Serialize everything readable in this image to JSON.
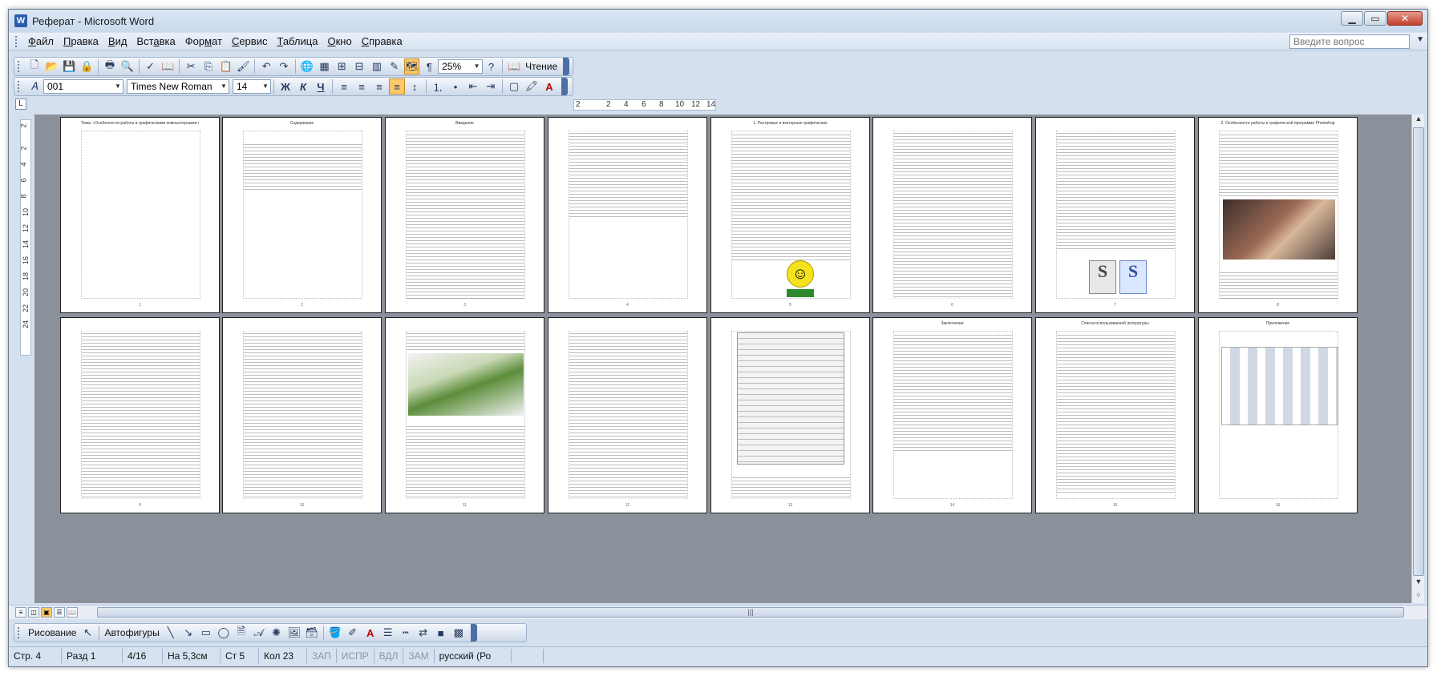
{
  "window": {
    "title": "Реферат - Microsoft Word",
    "app_icon": "W"
  },
  "menu": [
    {
      "pre": "",
      "u": "Ф",
      "post": "айл"
    },
    {
      "pre": "",
      "u": "П",
      "post": "равка"
    },
    {
      "pre": "",
      "u": "В",
      "post": "ид"
    },
    {
      "pre": "Вст",
      "u": "а",
      "post": "вка"
    },
    {
      "pre": "Фор",
      "u": "м",
      "post": "ат"
    },
    {
      "pre": "",
      "u": "С",
      "post": "ервис"
    },
    {
      "pre": "",
      "u": "Т",
      "post": "аблица"
    },
    {
      "pre": "",
      "u": "О",
      "post": "кно"
    },
    {
      "pre": "",
      "u": "С",
      "post": "правка"
    }
  ],
  "help_box": {
    "placeholder": "Введите вопрос"
  },
  "standard_toolbar": {
    "zoom": "25%",
    "read_label": "Чтение"
  },
  "formatting_toolbar": {
    "style": "001",
    "font": "Times New Roman",
    "size": "14",
    "bold": "Ж",
    "italic": "К",
    "underline": "Ч"
  },
  "ruler": {
    "ticks": [
      "2",
      "2",
      "4",
      "6",
      "8",
      "10",
      "12",
      "14"
    ],
    "vticks": [
      "2",
      "2",
      "4",
      "6",
      "8",
      "10",
      "12",
      "14",
      "16",
      "18",
      "20",
      "22",
      "24"
    ]
  },
  "pages": [
    {
      "title": "Тема: «Особенности работы в графическими компьютерными программами»"
    },
    {
      "title": "Содержание"
    },
    {
      "title": "Введение"
    },
    {
      "title": ""
    },
    {
      "title": "1. Растровые и векторные графические"
    },
    {
      "title": ""
    },
    {
      "title": ""
    },
    {
      "title": "2. Особенности работы в графической программе Photoshop"
    },
    {
      "title": ""
    },
    {
      "title": ""
    },
    {
      "title": ""
    },
    {
      "title": ""
    },
    {
      "title": ""
    },
    {
      "title": "Заключение"
    },
    {
      "title": "Список использованной литературы"
    },
    {
      "title": "Приложение"
    }
  ],
  "drawing_toolbar": {
    "draw_label": "Рисование",
    "autoshapes_label": "Автофигуры"
  },
  "status": {
    "page": "Стр. 4",
    "section": "Разд 1",
    "pages": "4/16",
    "at": "На 5,3см",
    "line": "Ст 5",
    "col": "Кол 23",
    "rec": "ЗАП",
    "trk": "ИСПР",
    "ext": "ВДЛ",
    "ovr": "ЗАМ",
    "lang": "русский (Ро"
  }
}
